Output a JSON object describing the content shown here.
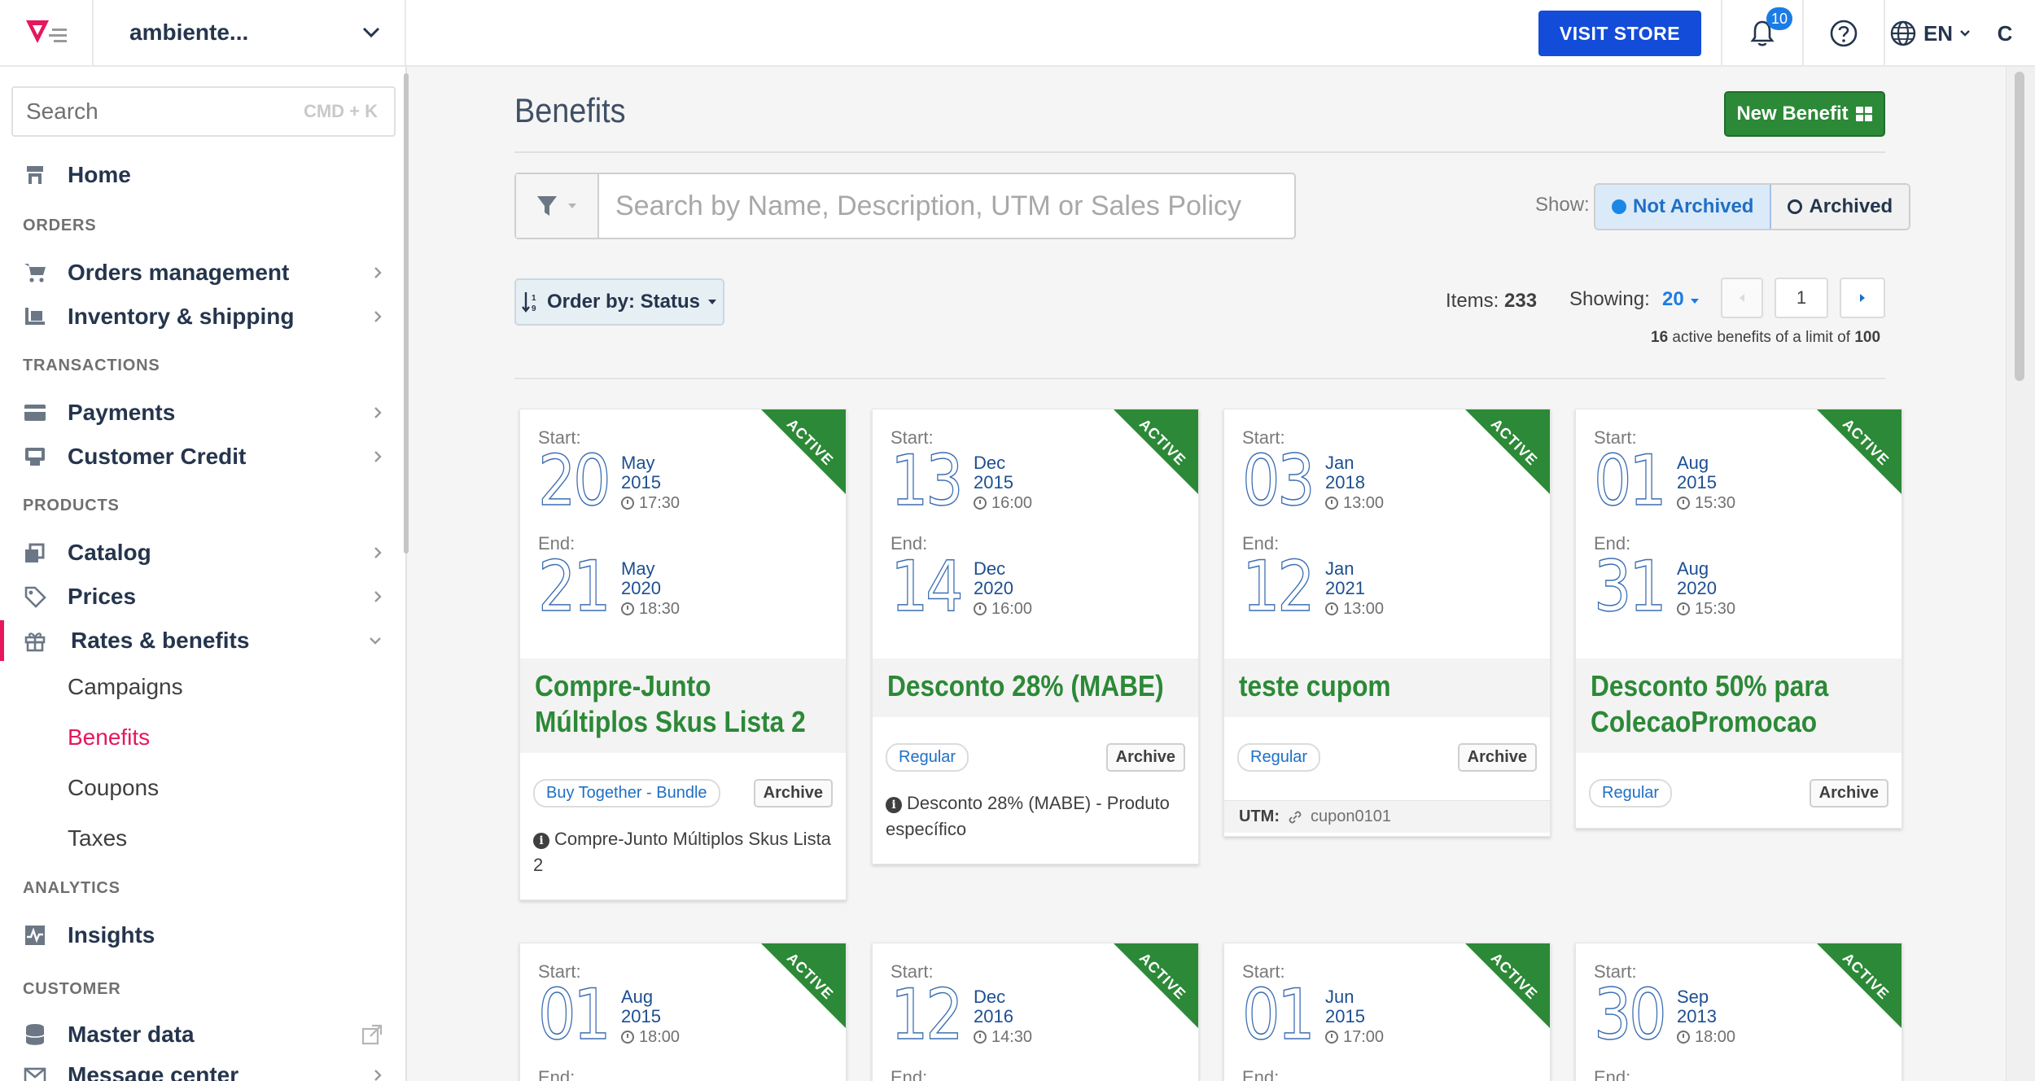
{
  "topbar": {
    "account_name": "ambiente...",
    "visit_store": "VISIT STORE",
    "notifications_count": "10",
    "language": "EN",
    "user_initial": "C"
  },
  "sidebar": {
    "search_placeholder": "Search",
    "search_shortcut": "CMD + K",
    "home": "Home",
    "section_orders": "ORDERS",
    "orders_management": "Orders management",
    "inventory_shipping": "Inventory & shipping",
    "section_transactions": "TRANSACTIONS",
    "payments": "Payments",
    "customer_credit": "Customer Credit",
    "section_products": "PRODUCTS",
    "catalog": "Catalog",
    "prices": "Prices",
    "rates_benefits": "Rates & benefits",
    "campaigns": "Campaigns",
    "benefits": "Benefits",
    "coupons": "Coupons",
    "taxes": "Taxes",
    "section_analytics": "ANALYTICS",
    "insights": "Insights",
    "section_customer": "CUSTOMER",
    "master_data": "Master data",
    "message_center": "Message center"
  },
  "main": {
    "title": "Benefits",
    "new_benefit": "New Benefit",
    "search_placeholder": "Search by Name, Description, UTM or Sales Policy",
    "show_label": "Show:",
    "not_archived": "Not Archived",
    "archived": "Archived",
    "order_by": "Order by: Status",
    "items_label": "Items:",
    "items_value": "233",
    "showing_label": "Showing:",
    "showing_value": "20",
    "page": "1",
    "limit_active": "16",
    "limit_text": "active benefits of a limit of",
    "limit_max": "100"
  },
  "labels": {
    "start": "Start:",
    "end": "End:",
    "active": "ACTIVE",
    "archive": "Archive",
    "utm": "UTM:"
  },
  "cards": [
    {
      "start": {
        "day": "20",
        "month": "May",
        "year": "2015",
        "time": "17:30"
      },
      "end": {
        "day": "21",
        "month": "May",
        "year": "2020",
        "time": "18:30"
      },
      "title_line1": "Compre-Junto",
      "title_line2": "Múltiplos Skus Lista 2",
      "tag": "Buy Together - Bundle",
      "desc": "Compre-Junto Múltiplos Skus Lista 2"
    },
    {
      "start": {
        "day": "13",
        "month": "Dec",
        "year": "2015",
        "time": "16:00"
      },
      "end": {
        "day": "14",
        "month": "Dec",
        "year": "2020",
        "time": "16:00"
      },
      "title_line1": "Desconto 28% (MABE)",
      "tag": "Regular",
      "desc": "Desconto 28% (MABE) - Produto específico"
    },
    {
      "start": {
        "day": "03",
        "month": "Jan",
        "year": "2018",
        "time": "13:00"
      },
      "end": {
        "day": "12",
        "month": "Jan",
        "year": "2021",
        "time": "13:00"
      },
      "title_line1": "teste cupom",
      "tag": "Regular",
      "utm": "cupon0101"
    },
    {
      "start": {
        "day": "01",
        "month": "Aug",
        "year": "2015",
        "time": "15:30"
      },
      "end": {
        "day": "31",
        "month": "Aug",
        "year": "2020",
        "time": "15:30"
      },
      "title_line1": "Desconto 50% para",
      "title_line2": "ColecaoPromocao",
      "tag": "Regular"
    },
    {
      "start": {
        "day": "01",
        "month": "Aug",
        "year": "2015",
        "time": "18:00"
      }
    },
    {
      "start": {
        "day": "12",
        "month": "Dec",
        "year": "2016",
        "time": "14:30"
      }
    },
    {
      "start": {
        "day": "01",
        "month": "Jun",
        "year": "2015",
        "time": "17:00"
      }
    },
    {
      "start": {
        "day": "30",
        "month": "Sep",
        "year": "2013",
        "time": "18:00"
      }
    }
  ],
  "colors": {
    "accent": "#134cd8",
    "active_green": "#2c8937",
    "brand_pink": "#e6175c",
    "link_blue": "#1f6fc5"
  }
}
